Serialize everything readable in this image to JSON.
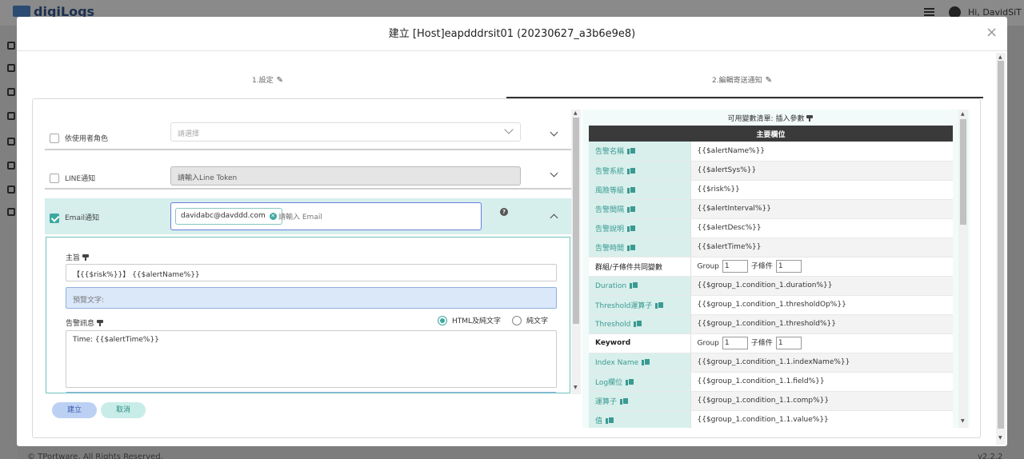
{
  "background": {
    "logo": "digiLogs",
    "user": "Hi, DavidSiT",
    "footer": "© TPortware. All Rights Reserved.",
    "version": "v2.2.2"
  },
  "modal": {
    "title": "建立 [Host]eapdddrsit01 (20230627_a3b6e9e8)",
    "close": "×"
  },
  "steps": [
    {
      "label": "1.設定"
    },
    {
      "label": "2.編輯寄送通知"
    }
  ],
  "left": {
    "role": {
      "label": "依使用者角色",
      "placeholder": "請選擇"
    },
    "line": {
      "label": "LINE通知",
      "placeholder": "請輸入Line Token"
    },
    "email": {
      "label": "Email通知",
      "tag": "davidabc@davddd.com",
      "placeholder": "請輸入 Email",
      "subject_label": "主旨",
      "subject_value": "【{{$risk%}}】 {{$alertName%}}",
      "preview_placeholder": "預覽文字:",
      "message_label": "告警訊息",
      "radio_html": "HTML及純文字",
      "radio_plain": "純文字",
      "message_value": "Time: {{$alertTime%}}"
    },
    "buttons": {
      "create": "建立",
      "cancel": "取消"
    }
  },
  "right": {
    "header_label": "可用變數清單:",
    "header_insert": "插入參數",
    "table_title": "主要欄位",
    "rows": [
      {
        "key": "告警名稱",
        "value": "{{$alertName%}}",
        "copy": true
      },
      {
        "key": "告警系統",
        "value": "{{$alertSys%}}",
        "copy": true
      },
      {
        "key": "風險等級",
        "value": "{{$risk%}}",
        "copy": true
      },
      {
        "key": "告警間隔",
        "value": "{{$alertInterval%}}",
        "copy": true
      },
      {
        "key": "告警說明",
        "value": "{{$alertDesc%}}",
        "copy": true
      },
      {
        "key": "告警時間",
        "value": "{{$alertTime%}}",
        "copy": true
      }
    ],
    "group_row": {
      "key": "群組/子條件共同變數",
      "group_label": "Group",
      "group_value": "1",
      "sub_label": "子條件",
      "sub_value": "1"
    },
    "cond_rows": [
      {
        "key": "Duration",
        "value": "{{$group_1.condition_1.duration%}}"
      },
      {
        "key": "Threshold運算子",
        "value": "{{$group_1.condition_1.thresholdOp%}}"
      },
      {
        "key": "Threshold",
        "value": "{{$group_1.condition_1.threshold%}}"
      }
    ],
    "keyword_row": {
      "key": "Keyword",
      "group_label": "Group",
      "group_value": "1",
      "sub_label": "子條件",
      "sub_value": "1"
    },
    "kw_rows": [
      {
        "key": "Index Name",
        "value": "{{$group_1.condition_1.1.indexName%}}"
      },
      {
        "key": "Log欄位",
        "value": "{{$group_1.condition_1.1.field%}}"
      },
      {
        "key": "運算子",
        "value": "{{$group_1.condition_1.1.comp%}}"
      },
      {
        "key": "值",
        "value": "{{$group_1.condition_1.1.value%}}"
      }
    ]
  }
}
